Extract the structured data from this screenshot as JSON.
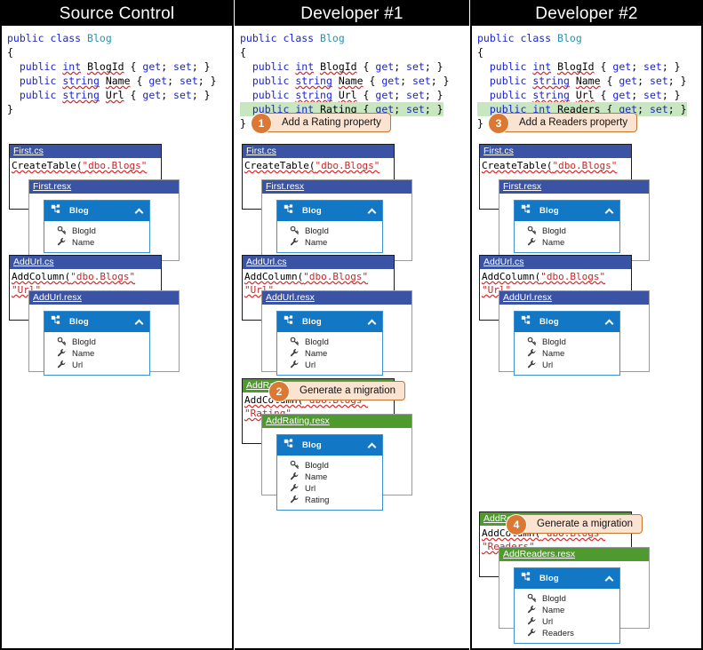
{
  "colors": {
    "header_bg": "#000000",
    "file_title_blue": "#3a53a4",
    "file_title_green": "#4f9a2e",
    "entity_header_blue": "#1277c4",
    "callout_bg": "#fbe3d2",
    "callout_border": "#c8762f",
    "callout_badge": "#dd7833",
    "code_keyword": "#1b24d4",
    "code_type": "#2b91af",
    "code_string": "#c62828",
    "highlight_green": "#c8e6c0"
  },
  "columns": [
    {
      "title": "Source Control",
      "code": {
        "line1_kw": "public class",
        "line1_type": "Blog",
        "open_brace": "{",
        "props": [
          {
            "mod": "public",
            "type": "int",
            "name": "BlogId",
            "accessors": "{ get; set; }",
            "highlight": false
          },
          {
            "mod": "public",
            "type": "string",
            "name": "Name",
            "accessors": "{ get; set; }",
            "highlight": false
          },
          {
            "mod": "public",
            "type": "string",
            "name": "Url",
            "accessors": "{ get; set; }",
            "highlight": false
          }
        ],
        "close_brace": "}"
      },
      "callout": null,
      "migrations": [
        {
          "cs_name": "First.cs",
          "cs_body": "CreateTable(\"dbo.Blogs\"",
          "cs_body_hidden": "",
          "resx_name": "First.resx",
          "green": false,
          "entity": "Blog",
          "properties": [
            {
              "name": "BlogId",
              "icon": "key-icon"
            },
            {
              "name": "Name",
              "icon": "property-icon"
            }
          ]
        },
        {
          "cs_name": "AddUrl.cs",
          "cs_body": "AddColumn(\"dbo.Blogs\"",
          "cs_body_hidden": "\"Url\"",
          "resx_name": "AddUrl.resx",
          "green": false,
          "entity": "Blog",
          "properties": [
            {
              "name": "BlogId",
              "icon": "key-icon"
            },
            {
              "name": "Name",
              "icon": "property-icon"
            },
            {
              "name": "Url",
              "icon": "property-icon"
            }
          ]
        }
      ]
    },
    {
      "title": "Developer #1",
      "code": {
        "line1_kw": "public class",
        "line1_type": "Blog",
        "open_brace": "{",
        "props": [
          {
            "mod": "public",
            "type": "int",
            "name": "BlogId",
            "accessors": "{ get; set; }",
            "highlight": false
          },
          {
            "mod": "public",
            "type": "string",
            "name": "Name",
            "accessors": "{ get; set; }",
            "highlight": false
          },
          {
            "mod": "public",
            "type": "string",
            "name": "Url",
            "accessors": "{ get; set; }",
            "highlight": false
          },
          {
            "mod": "public",
            "type": "int",
            "name": "Rating",
            "accessors": "{ get; set; }",
            "highlight": true
          }
        ],
        "close_brace": "}"
      },
      "callout": {
        "number": "1",
        "text": "Add a Rating property"
      },
      "migrations": [
        {
          "cs_name": "First.cs",
          "cs_body": "CreateTable(\"dbo.Blogs\"",
          "cs_body_hidden": "",
          "resx_name": "First.resx",
          "green": false,
          "entity": "Blog",
          "properties": [
            {
              "name": "BlogId",
              "icon": "key-icon"
            },
            {
              "name": "Name",
              "icon": "property-icon"
            }
          ]
        },
        {
          "cs_name": "AddUrl.cs",
          "cs_body": "AddColumn(\"dbo.Blogs\"",
          "cs_body_hidden": "\"Url\"",
          "resx_name": "AddUrl.resx",
          "green": false,
          "entity": "Blog",
          "properties": [
            {
              "name": "BlogId",
              "icon": "key-icon"
            },
            {
              "name": "Name",
              "icon": "property-icon"
            },
            {
              "name": "Url",
              "icon": "property-icon"
            }
          ]
        },
        {
          "cs_name": "AddRating.cs",
          "cs_body": "AddColumn(\"dbo.Blogs\"",
          "cs_body_hidden": "\"Rating\"",
          "resx_name": "AddRating.resx",
          "green": true,
          "entity": "Blog",
          "properties": [
            {
              "name": "BlogId",
              "icon": "key-icon"
            },
            {
              "name": "Name",
              "icon": "property-icon"
            },
            {
              "name": "Url",
              "icon": "property-icon"
            },
            {
              "name": "Rating",
              "icon": "property-icon"
            }
          ],
          "callout": {
            "number": "2",
            "text": "Generate a migration"
          }
        }
      ]
    },
    {
      "title": "Developer #2",
      "code": {
        "line1_kw": "public class",
        "line1_type": "Blog",
        "open_brace": "{",
        "props": [
          {
            "mod": "public",
            "type": "int",
            "name": "BlogId",
            "accessors": "{ get; set; }",
            "highlight": false
          },
          {
            "mod": "public",
            "type": "string",
            "name": "Name",
            "accessors": "{ get; set; }",
            "highlight": false
          },
          {
            "mod": "public",
            "type": "string",
            "name": "Url",
            "accessors": "{ get; set; }",
            "highlight": false
          },
          {
            "mod": "public",
            "type": "int",
            "name": "Readers",
            "accessors": "{ get; set; }",
            "highlight": true
          }
        ],
        "close_brace": "}"
      },
      "callout": {
        "number": "3",
        "text": "Add a Readers property"
      },
      "migrations": [
        {
          "cs_name": "First.cs",
          "cs_body": "CreateTable(\"dbo.Blogs\"",
          "cs_body_hidden": "",
          "resx_name": "First.resx",
          "green": false,
          "entity": "Blog",
          "properties": [
            {
              "name": "BlogId",
              "icon": "key-icon"
            },
            {
              "name": "Name",
              "icon": "property-icon"
            }
          ]
        },
        {
          "cs_name": "AddUrl.cs",
          "cs_body": "AddColumn(\"dbo.Blogs\"",
          "cs_body_hidden": "\"Url\"",
          "resx_name": "AddUrl.resx",
          "green": false,
          "entity": "Blog",
          "properties": [
            {
              "name": "BlogId",
              "icon": "key-icon"
            },
            {
              "name": "Name",
              "icon": "property-icon"
            },
            {
              "name": "Url",
              "icon": "property-icon"
            }
          ]
        },
        {
          "cs_name": "AddReaders.cs",
          "cs_body": "AddColumn(\"dbo.Blogs\"",
          "cs_body_hidden": "\"Readers\"",
          "resx_name": "AddReaders.resx",
          "green": true,
          "entity": "Blog",
          "properties": [
            {
              "name": "BlogId",
              "icon": "key-icon"
            },
            {
              "name": "Name",
              "icon": "property-icon"
            },
            {
              "name": "Url",
              "icon": "property-icon"
            },
            {
              "name": "Readers",
              "icon": "property-icon"
            }
          ],
          "callout": {
            "number": "4",
            "text": "Generate a migration"
          }
        }
      ]
    }
  ]
}
